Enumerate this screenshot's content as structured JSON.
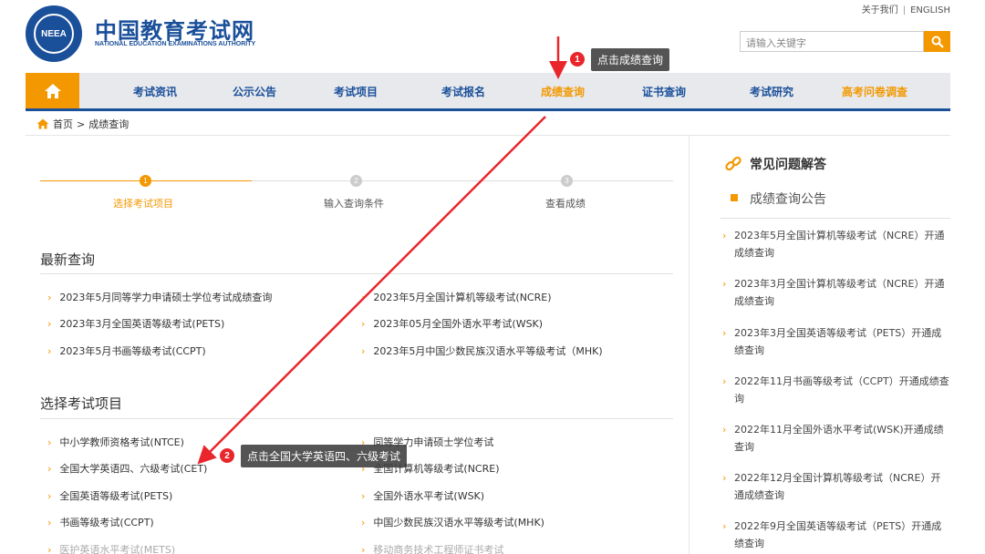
{
  "header": {
    "emblem_text": "NEEA",
    "site_title": "中国教育考试网",
    "site_subtitle": "NATIONAL EDUCATION EXAMINATIONS AUTHORITY",
    "about_link": "关于我们",
    "separator": "|",
    "english_link": "ENGLISH",
    "search_placeholder": "请输入关键字"
  },
  "nav": {
    "items": [
      "考试资讯",
      "公示公告",
      "考试项目",
      "考试报名",
      "成绩查询",
      "证书查询",
      "考试研究",
      "高考问卷调查"
    ],
    "active_index": 4
  },
  "breadcrumb": {
    "home": "首页",
    "sep": ">",
    "current": "成绩查询"
  },
  "steps": [
    {
      "num": "1",
      "label": "选择考试项目"
    },
    {
      "num": "2",
      "label": "输入查询条件"
    },
    {
      "num": "3",
      "label": "查看成绩"
    }
  ],
  "recent": {
    "title": "最新查询",
    "left": [
      "2023年5月同等学力申请硕士学位考试成绩查询",
      "2023年3月全国英语等级考试(PETS)",
      "2023年5月书画等级考试(CCPT)"
    ],
    "right": [
      "2023年5月全国计算机等级考试(NCRE)",
      "2023年05月全国外语水平考试(WSK)",
      "2023年5月中国少数民族汉语水平等级考试（MHK)"
    ]
  },
  "select": {
    "title": "选择考试项目",
    "left": [
      "中小学教师资格考试(NTCE)",
      "全国大学英语四、六级考试(CET)",
      "全国英语等级考试(PETS)",
      "书画等级考试(CCPT)",
      "医护英语水平考试(METS)"
    ],
    "right": [
      "同等学力申请硕士学位考试",
      "全国计算机等级考试(NCRE)",
      "全国外语水平考试(WSK)",
      "中国少数民族汉语水平等级考试(MHK)",
      "移动商务技术工程师证书考试"
    ]
  },
  "sidebar": {
    "faq_title": "常见问题解答",
    "notice_title": "成绩查询公告",
    "notices": [
      "2023年5月全国计算机等级考试（NCRE）开通成绩查询",
      "2023年3月全国计算机等级考试（NCRE）开通成绩查询",
      "2023年3月全国英语等级考试（PETS）开通成绩查询",
      "2022年11月书画等级考试（CCPT）开通成绩查询",
      "2022年11月全国外语水平考试(WSK)开通成绩查询",
      "2022年12月全国计算机等级考试（NCRE）开通成绩查询",
      "2022年9月全国英语等级考试（PETS）开通成绩查询"
    ]
  },
  "annotations": {
    "step1_num": "1",
    "step1_text": "点击成绩查询",
    "step2_num": "2",
    "step2_text": "点击全国大学英语四、六级考试"
  },
  "colors": {
    "brand_blue": "#1a4f9a",
    "accent_orange": "#f39800",
    "annotation_red": "#e8262c"
  }
}
